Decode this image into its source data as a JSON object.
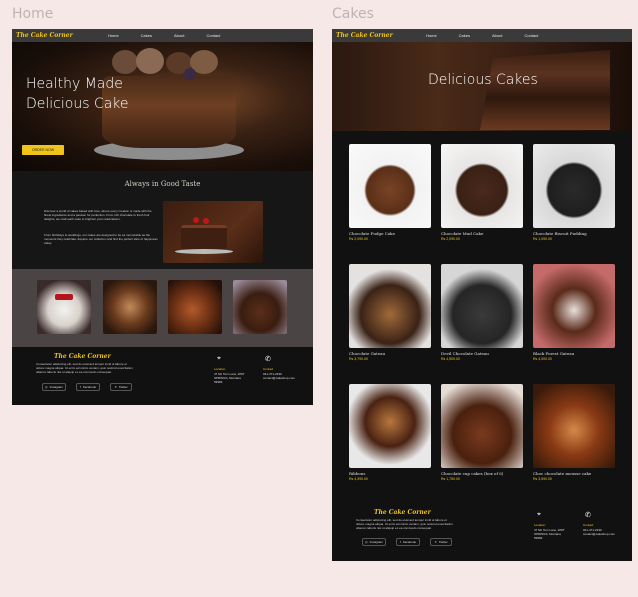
{
  "frames": {
    "home_label": "Home",
    "cakes_label": "Cakes"
  },
  "brand": {
    "logo": "The Cake Corner",
    "accent": "#f0c419"
  },
  "nav": [
    "Home",
    "Cakes",
    "About",
    "Contact"
  ],
  "home": {
    "hero_line1": "Healthy Made",
    "hero_line2": "Delicious Cake",
    "order_button": "ORDER NOW",
    "section_title": "Always in Good Taste",
    "para1": "Discover a world of cakes baked with love, where every creation is made with the finest ingredients and a passion for perfection. From rich chocolate to fresh fruit delights, we craft each cake to brighten your celebrations.",
    "para2": "From birthdays to weddings, our cakes are designed to be as memorable as the moments they celebrate. Explore our collection and find the perfect slice of happiness today."
  },
  "cakes": {
    "hero_title": "Delicious Cakes",
    "items": [
      {
        "name": "Chocolate Fudge Cake",
        "price": "Rs 2,090.00"
      },
      {
        "name": "Chocolate Mud Cake",
        "price": "Rs 2,090.00"
      },
      {
        "name": "Chocolate Biscuit Pudding",
        "price": "Rs 1,090.00"
      },
      {
        "name": "Chocolate Gateau",
        "price": "Rs 3,790.00"
      },
      {
        "name": "Devil Chocolate Gateau",
        "price": "Rs 4,500.00"
      },
      {
        "name": "Black Forest Gateau",
        "price": "Rs 4,000.00"
      },
      {
        "name": "Ribbons",
        "price": "Rs 4,390.00"
      },
      {
        "name": "Chocolate cup cakes (box of 6)",
        "price": "Rs 1,750.00"
      },
      {
        "name": "Choc chocolate mousse cake",
        "price": "Rs 3,590.00"
      }
    ]
  },
  "footer": {
    "logo": "The Cake Corner",
    "text": "Consectetur adipiscing elit, sed do eiusmod tempor incid ut labore et dolore magna aliqua. Ut enim ad minim veniam, quis nostrud exercitation ullamco laboris nisi ut aliquip ex ea commodo consequat.",
    "social": [
      "Instagram",
      "Facebook",
      "Twitter"
    ],
    "location_label": "Location",
    "location_text": "47 Mc Tom Lane, WDT SPRINGS, Montana 59983",
    "contact_label": "Contact",
    "contact_text": "041-471-2330 contact@cakeshop.com"
  }
}
